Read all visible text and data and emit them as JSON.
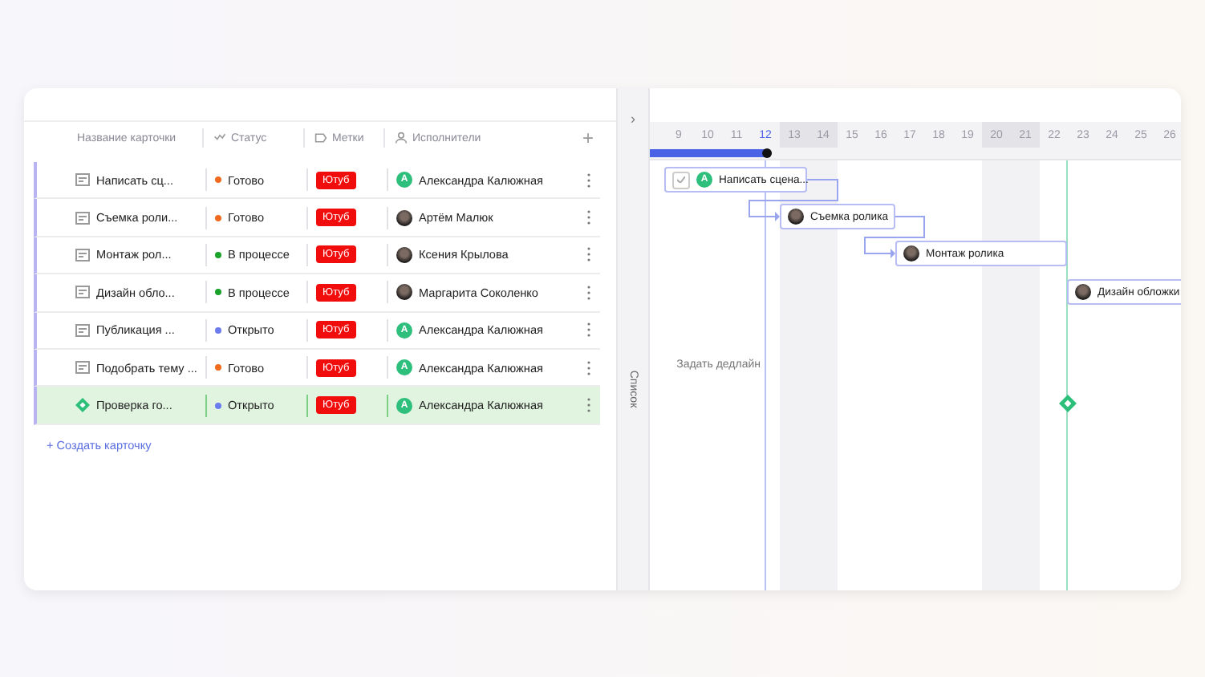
{
  "table": {
    "columns": [
      {
        "label": "Название карточки"
      },
      {
        "label": "Статус"
      },
      {
        "label": "Метки"
      },
      {
        "label": "Исполнители"
      }
    ],
    "add_column": "+",
    "rows": [
      {
        "kind": "card",
        "title": "Написать сц...",
        "status": "Готово",
        "color": "#f26b1d",
        "tag": "Ютуб",
        "assignee": "Александра Калюжная",
        "initial": "A",
        "selected": false
      },
      {
        "kind": "card",
        "title": "Съемка роли...",
        "status": "Готово",
        "color": "#f26b1d",
        "tag": "Ютуб",
        "assignee": "Артём Малюк",
        "selected": false
      },
      {
        "kind": "card",
        "title": "Монтаж рол...",
        "status": "В процессе",
        "color": "#1aa32a",
        "tag": "Ютуб",
        "assignee": "Ксения Крылова",
        "selected": false
      },
      {
        "kind": "card",
        "title": "Дизайн облo...",
        "status": "В процессе",
        "color": "#1aa32a",
        "tag": "Ютуб",
        "assignee": "Маргарита Соколенко",
        "selected": false
      },
      {
        "kind": "card",
        "title": "Публикация ...",
        "status": "Открыто",
        "color": "#6b7cf0",
        "tag": "Ютуб",
        "assignee": "Александра Калюжная",
        "initial": "A",
        "selected": false
      },
      {
        "kind": "card",
        "title": "Подобрать тему ...",
        "status": "Готово",
        "color": "#f26b1d",
        "tag": "Ютуб",
        "assignee": "Александра Калюжная",
        "initial": "A",
        "selected": false
      },
      {
        "kind": "milestone",
        "title": "Проверка го...",
        "status": "Открыто",
        "color": "#6b7cf0",
        "tag": "Ютуб",
        "assignee": "Александра Калюжная",
        "initial": "A",
        "selected": true
      }
    ],
    "create_link": "+ Создать карточку"
  },
  "gantt": {
    "side_label": "Список",
    "expand": "›",
    "days": [
      {
        "label": "9",
        "weekend": false,
        "today": false
      },
      {
        "label": "10",
        "weekend": false,
        "today": false
      },
      {
        "label": "11",
        "weekend": false,
        "today": false
      },
      {
        "label": "12",
        "weekend": false,
        "today": true
      },
      {
        "label": "13",
        "weekend": true,
        "today": false
      },
      {
        "label": "14",
        "weekend": true,
        "today": false
      },
      {
        "label": "15",
        "weekend": false,
        "today": false
      },
      {
        "label": "16",
        "weekend": false,
        "today": false
      },
      {
        "label": "17",
        "weekend": false,
        "today": false
      },
      {
        "label": "18",
        "weekend": false,
        "today": false
      },
      {
        "label": "19",
        "weekend": false,
        "today": false
      },
      {
        "label": "20",
        "weekend": true,
        "today": false
      },
      {
        "label": "21",
        "weekend": true,
        "today": false
      },
      {
        "label": "22",
        "weekend": false,
        "today": false
      },
      {
        "label": "23",
        "weekend": false,
        "today": false
      },
      {
        "label": "24",
        "weekend": false,
        "today": false
      },
      {
        "label": "25",
        "weekend": false,
        "today": false
      },
      {
        "label": "26",
        "weekend": false,
        "today": false
      }
    ],
    "progress": {
      "level": 0.22
    },
    "bars": [
      {
        "label": "Написать сцена...",
        "initial": "A",
        "checkbox": true
      },
      {
        "label": "Съемка ролика",
        "checkbox": false
      },
      {
        "label": "Монтаж ролика",
        "checkbox": false
      },
      {
        "label": "Дизайн обложки",
        "checkbox": false
      }
    ],
    "deadline_hint": "Задать дедлайн"
  }
}
